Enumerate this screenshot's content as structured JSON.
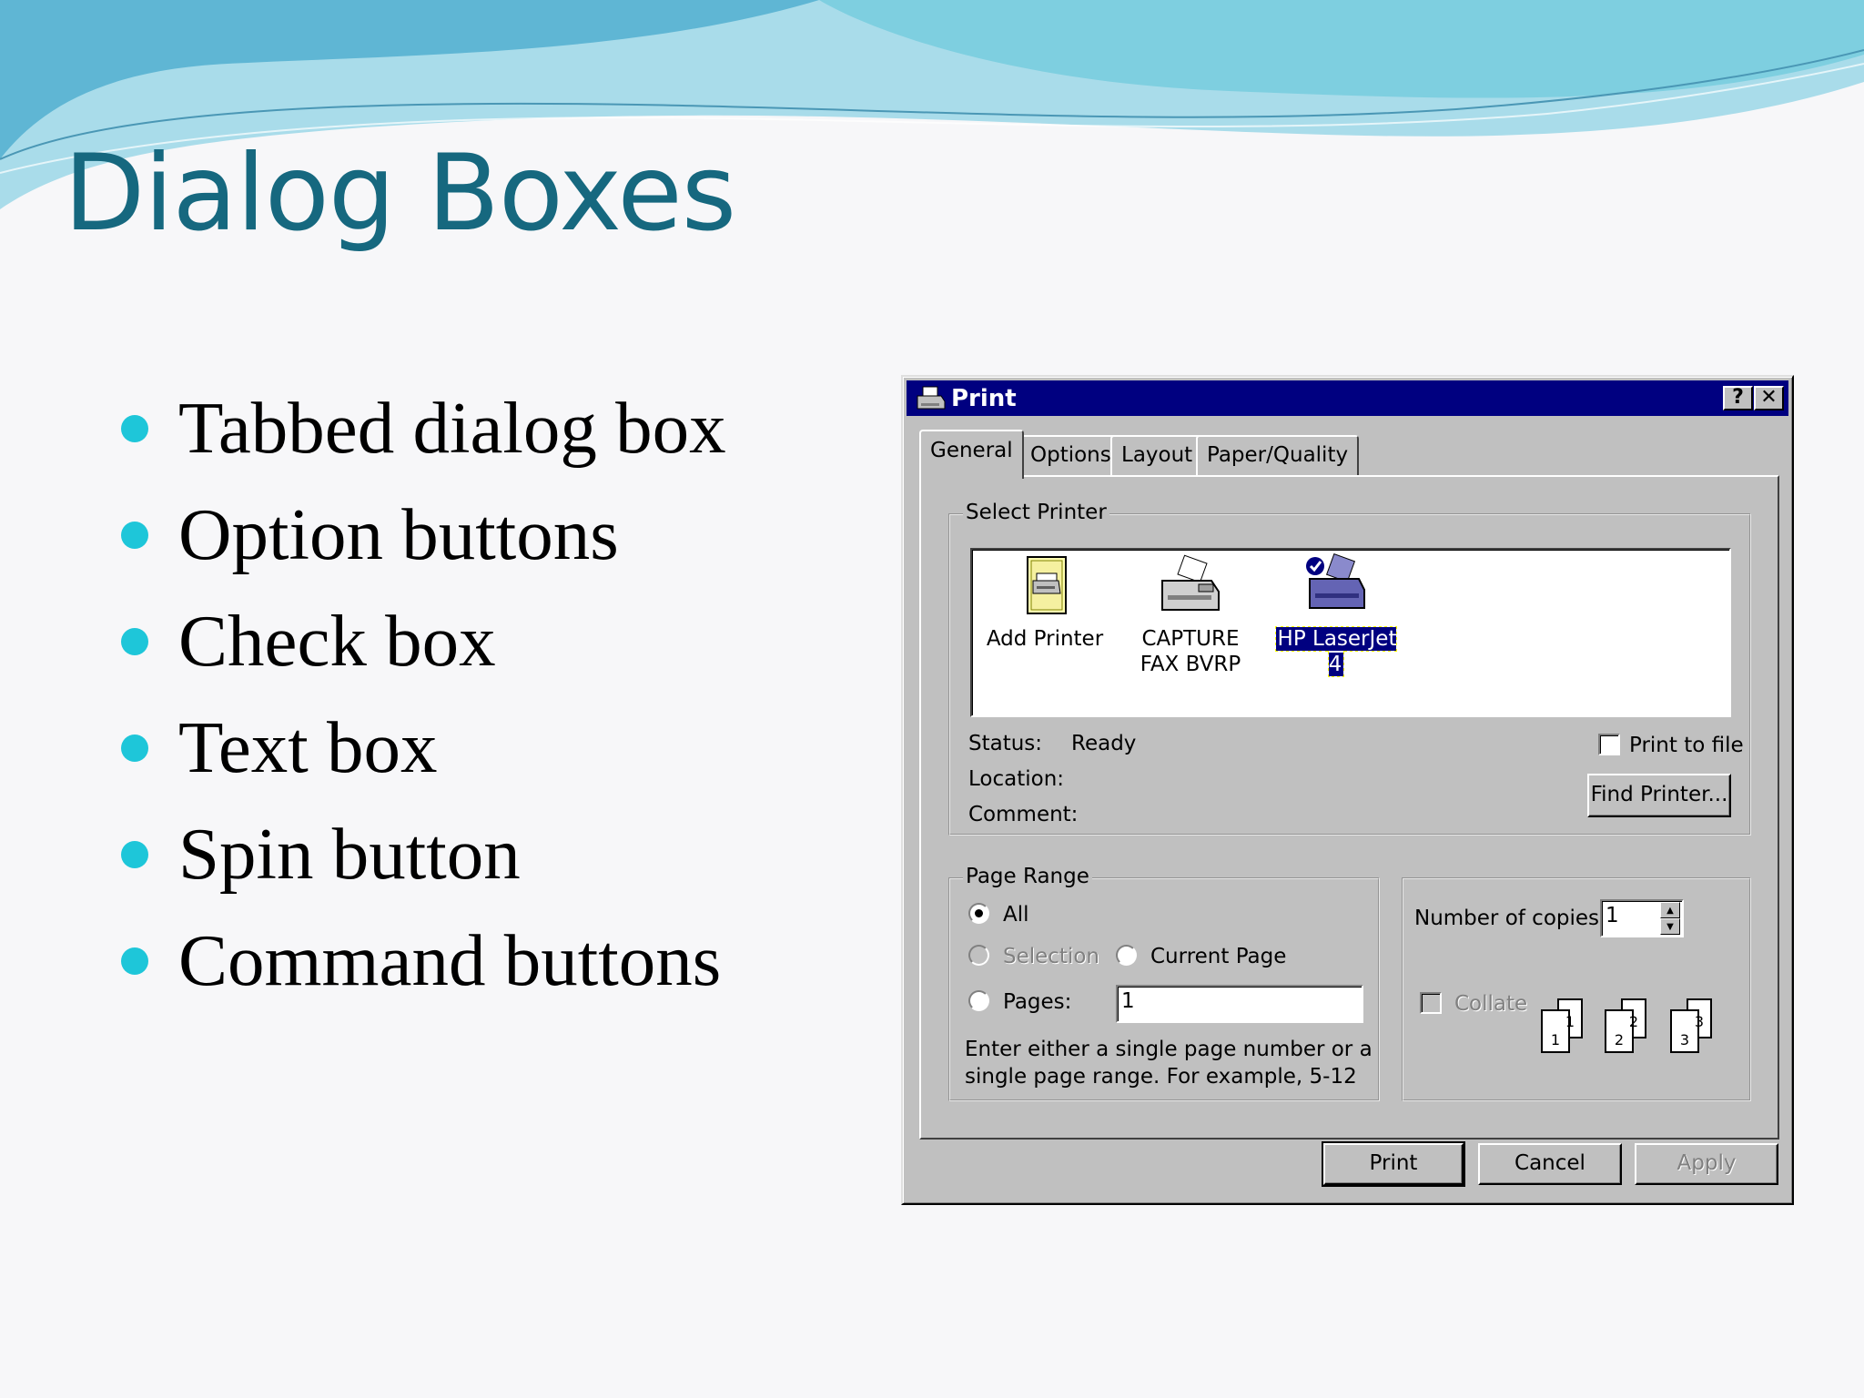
{
  "slide": {
    "title": "Dialog Boxes",
    "bullets": [
      "Tabbed dialog box",
      "Option buttons",
      "Check box",
      "Text box",
      "Spin button",
      "Command buttons"
    ],
    "colors": {
      "title": "#16687f",
      "bullet": "#1ec6d9",
      "wave_light": "#8fd5e6",
      "wave_dark": "#4aa9c9"
    }
  },
  "dialog": {
    "title": "Print",
    "title_icon": "printer-icon",
    "help_label": "?",
    "close_label": "✕",
    "tabs": [
      "General",
      "Options",
      "Layout",
      "Paper/Quality"
    ],
    "active_tab": "General",
    "select_printer": {
      "legend": "Select Printer",
      "printers": [
        {
          "label": "Add Printer",
          "icon": "add-printer-icon"
        },
        {
          "label": "CAPTURE FAX BVRP",
          "icon": "fax-printer-icon"
        },
        {
          "label": "HP LaserJet 4",
          "icon": "laser-printer-icon",
          "selected": true
        }
      ],
      "status_label": "Status:",
      "status_value": "Ready",
      "location_label": "Location:",
      "comment_label": "Comment:",
      "print_to_file": "Print to file",
      "find_printer": "Find Printer..."
    },
    "page_range": {
      "legend": "Page Range",
      "all": "All",
      "selection": "Selection",
      "current_page": "Current Page",
      "pages": "Pages:",
      "pages_value": "1",
      "hint": "Enter either a single page number or a single page range.  For example, 5-12"
    },
    "copies": {
      "label": "Number of copies:",
      "value": "1",
      "collate": "Collate",
      "collate_pages": [
        "1",
        "1",
        "2",
        "2",
        "3",
        "3"
      ]
    },
    "buttons": {
      "print": "Print",
      "cancel": "Cancel",
      "apply": "Apply"
    }
  }
}
